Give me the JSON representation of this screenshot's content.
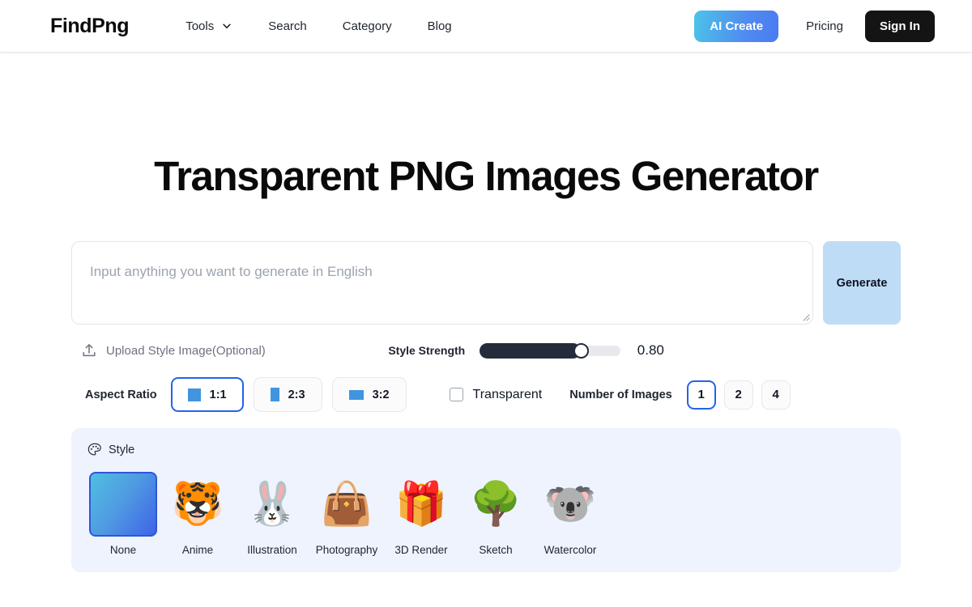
{
  "header": {
    "brand": "FindPng",
    "nav": [
      {
        "label": "Tools",
        "icon": "chevron-down-icon",
        "has_chevron": true
      },
      {
        "label": "Search",
        "has_chevron": false
      },
      {
        "label": "Category",
        "has_chevron": false
      },
      {
        "label": "Blog",
        "has_chevron": false
      }
    ],
    "ai_create_label": "AI Create",
    "pricing_label": "Pricing",
    "sign_in_label": "Sign In",
    "ai_create_gradient_from": "#4dc3e8",
    "ai_create_gradient_to": "#4a7bf2",
    "sign_in_bg": "#141414"
  },
  "main": {
    "title": "Transparent PNG Images Generator",
    "prompt": {
      "value": "",
      "placeholder": "Input anything you want to generate in English"
    },
    "generate_label": "Generate",
    "generate_bg": "#bfdcf7"
  },
  "options": {
    "upload_label": "Upload Style Image(Optional)",
    "upload_icon": "upload-icon",
    "style_strength_label": "Style Strength",
    "style_strength_value": "0.80",
    "style_strength_percent": 72,
    "aspect_ratio_label": "Aspect Ratio",
    "aspect_ratios": [
      {
        "label": "1:1",
        "selected": true
      },
      {
        "label": "2:3",
        "selected": false
      },
      {
        "label": "3:2",
        "selected": false
      }
    ],
    "transparent_label": "Transparent",
    "transparent_checked": false,
    "number_of_images_label": "Number of Images",
    "image_counts": [
      {
        "label": "1",
        "selected": true
      },
      {
        "label": "2",
        "selected": false
      },
      {
        "label": "4",
        "selected": false
      }
    ],
    "accent_color": "#2563eb",
    "ratio_glyph_color": "#4094e0"
  },
  "style_panel": {
    "heading": "Style",
    "heading_icon": "palette-icon",
    "background": "#eef3fe",
    "styles": [
      {
        "label": "None",
        "thumb": "gradient-swatch",
        "glyph": "",
        "selected": true
      },
      {
        "label": "Anime",
        "thumb": "tiger-image",
        "glyph": "🐯",
        "selected": false
      },
      {
        "label": "Illustration",
        "thumb": "rabbit-image",
        "glyph": "🐰",
        "selected": false
      },
      {
        "label": "Photography",
        "thumb": "handbag-image",
        "glyph": "👜",
        "selected": false
      },
      {
        "label": "3D Render",
        "thumb": "giftbox-image",
        "glyph": "🎁",
        "selected": false
      },
      {
        "label": "Sketch",
        "thumb": "tree-image",
        "glyph": "🌳",
        "selected": false
      },
      {
        "label": "Watercolor",
        "thumb": "koala-image",
        "glyph": "🐨",
        "selected": false
      }
    ]
  }
}
